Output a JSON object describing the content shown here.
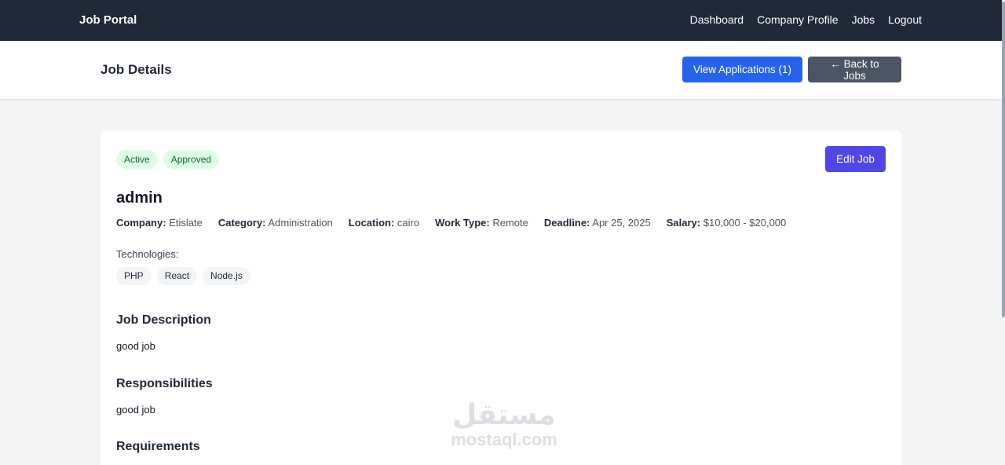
{
  "nav": {
    "brand": "Job Portal",
    "links": [
      "Dashboard",
      "Company Profile",
      "Jobs",
      "Logout"
    ]
  },
  "header": {
    "title": "Job Details",
    "view_applications": "View Applications (1)",
    "back": "← Back to Jobs"
  },
  "job": {
    "badges": [
      "Active",
      "Approved"
    ],
    "edit_label": "Edit Job",
    "title": "admin",
    "meta": [
      {
        "key": "Company:",
        "value": "Etislate"
      },
      {
        "key": "Category:",
        "value": "Administration"
      },
      {
        "key": "Location:",
        "value": "cairo"
      },
      {
        "key": "Work Type:",
        "value": "Remote"
      },
      {
        "key": "Deadline:",
        "value": "Apr 25, 2025"
      },
      {
        "key": "Salary:",
        "value": "$10,000 - $20,000"
      }
    ],
    "technologies_label": "Technologies:",
    "technologies": [
      "PHP",
      "React",
      "Node.js"
    ],
    "sections": [
      {
        "heading": "Job Description",
        "text": "good job"
      },
      {
        "heading": "Responsibilities",
        "text": "good job"
      },
      {
        "heading": "Requirements",
        "text": ""
      }
    ]
  },
  "watermark": {
    "arabic": "مستقل",
    "latin": "mostaql.com"
  },
  "colors": {
    "nav_bg": "#1f2937",
    "primary": "#2563eb",
    "secondary": "#4b5563",
    "edit": "#4f46e5",
    "badge_bg": "#dcfce7",
    "badge_text": "#166534"
  }
}
